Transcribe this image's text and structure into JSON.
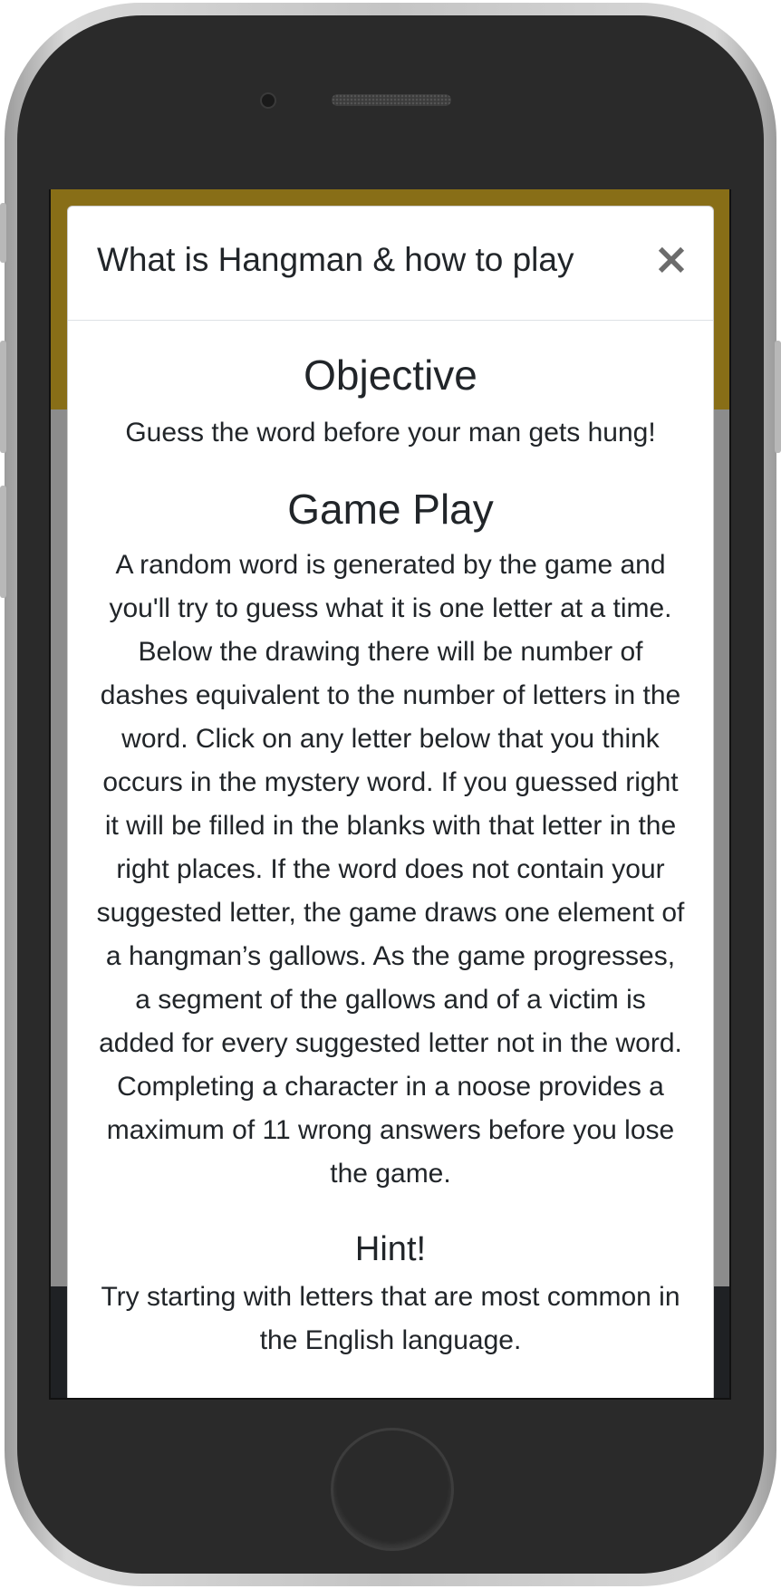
{
  "modal": {
    "title": "What is Hangman & how to play",
    "close_symbol": "×",
    "sections": {
      "objective_heading": "Objective",
      "objective_text": "Guess the word before your man gets hung!",
      "gameplay_heading": "Game Play",
      "gameplay_text": "A random word is generated by the game and you'll try to guess what it is one letter at a time. Below the drawing there will be number of dashes equivalent to the number of letters in the word. Click on any letter below that you think occurs in the mystery word. If you guessed right it will be filled in the blanks with that letter in the right places. If the word does not contain your suggested letter, the game draws one element of a hangman’s gallows. As the game progresses, a segment of the gallows and of a victim is added for every suggested letter not in the word. Completing a character in a noose provides a maximum of 11 wrong answers before you lose the game.",
      "hint_heading": "Hint!",
      "hint_text": "Try starting with letters that are most common in the English language."
    }
  },
  "colors": {
    "header_gold": "#886e17",
    "overlay_gray": "#8c8c8c",
    "footer_dark": "#1f2124",
    "text": "#212529"
  },
  "icons": {
    "close": "close-icon"
  }
}
